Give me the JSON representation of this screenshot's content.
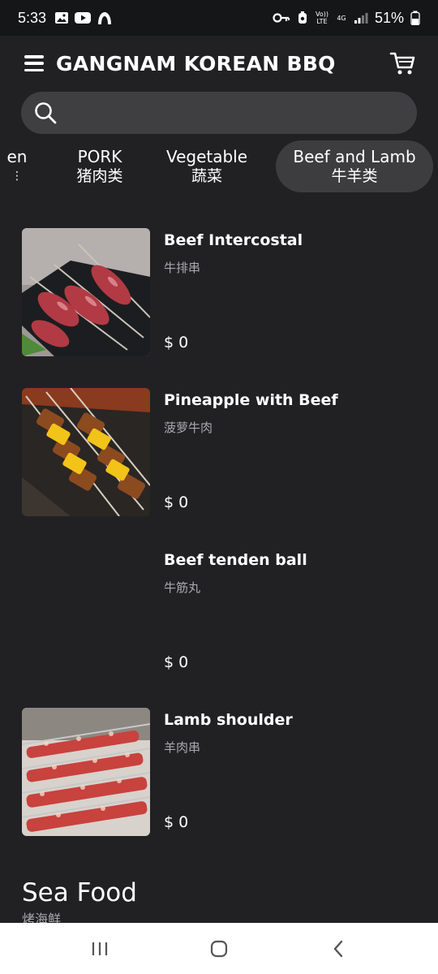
{
  "status_bar": {
    "time": "5:33",
    "battery": "51%",
    "volte_label": "Vo)) LTE",
    "network_label": "4G"
  },
  "app_bar": {
    "title": "GANGNAM KOREAN BBQ"
  },
  "search": {
    "value": "",
    "placeholder": ""
  },
  "category_tabs": [
    {
      "en": "en",
      "cn": "⋮"
    },
    {
      "en": "PORK",
      "cn": "猪肉类"
    },
    {
      "en": "Vegetable",
      "cn": "蔬菜"
    },
    {
      "en": "Beef and Lamb",
      "cn": "牛羊类",
      "active": true
    }
  ],
  "items": [
    {
      "name": "Beef Intercostal",
      "subtitle": "牛排串",
      "price": "$ 0"
    },
    {
      "name": "Pineapple with Beef",
      "subtitle": "菠萝牛肉",
      "price": "$ 0"
    },
    {
      "name": "Beef tenden ball",
      "subtitle": "牛筋丸",
      "price": "$ 0"
    },
    {
      "name": "Lamb shoulder",
      "subtitle": "羊肉串",
      "price": "$ 0"
    }
  ],
  "next_section": {
    "title": "Sea Food",
    "subtitle": "烤海鲜"
  },
  "colors": {
    "background": "#212124",
    "status_bar": "#151618",
    "search_bg": "#3f3f42",
    "active_tab_bg": "#3d3d40",
    "subtitle_text": "#a9a9ad",
    "nav_bar": "#ffffff"
  },
  "icons": {
    "menu": "hamburger-menu-icon",
    "cart": "shopping-cart-icon",
    "search": "search-icon",
    "nav_recents": "recents-icon",
    "nav_home": "home-icon",
    "nav_back": "back-icon"
  }
}
